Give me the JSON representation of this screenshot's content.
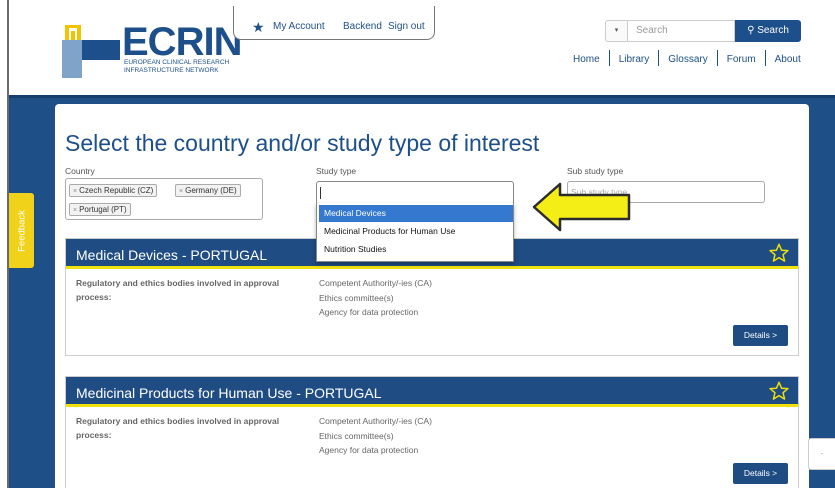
{
  "header": {
    "logo": {
      "word": "ECRIN",
      "subtitle_line1": "EUROPEAN CLINICAL RESEARCH",
      "subtitle_line2": "INFRASTRUCTURE NETWORK"
    },
    "account_links": [
      "My Account",
      "Backend",
      "Sign out"
    ],
    "search": {
      "placeholder": "Search",
      "button_label": "Search",
      "dropdown_caret": "▾"
    },
    "nav": [
      "Home",
      "Library",
      "Glossary",
      "Forum",
      "About"
    ]
  },
  "main": {
    "title": "Select the country and/or study type of interest",
    "country": {
      "label": "Country",
      "tags": [
        "Czech Republic (CZ)",
        "Germany (DE)",
        "Portugal (PT)"
      ],
      "remove_glyph": "×"
    },
    "study_type": {
      "label": "Study type",
      "value": "",
      "options": [
        "Medical Devices",
        "Medicinal Products for Human Use",
        "Nutrition Studies"
      ],
      "highlighted": "Medical Devices"
    },
    "sub_study_type": {
      "label": "Sub study type",
      "placeholder": "Sub study type"
    }
  },
  "cards": [
    {
      "title": "Medical Devices - PORTUGAL",
      "label": "Regulatory and ethics bodies involved in approval process:",
      "items": [
        "Competent Authority/-ies (CA)",
        "Ethics committee(s)",
        "Agency for data protection"
      ],
      "button": "Details >"
    },
    {
      "title": "Medicinal Products for Human Use - PORTUGAL",
      "label": "Regulatory and ethics bodies involved in approval process:",
      "items": [
        "Competent Authority/-ies (CA)",
        "Ethics committee(s)",
        "Agency for data protection"
      ],
      "button": "Details >"
    }
  ],
  "feedback_tab": "Feedback",
  "side_tab_glyph": "·",
  "colors": {
    "brand_blue": "#1d4f8a",
    "band_blue": "#1e4f86",
    "accent_yellow": "#f1e00a",
    "selection_blue": "#3478cf",
    "feedback_yellow": "#f0d21a"
  }
}
